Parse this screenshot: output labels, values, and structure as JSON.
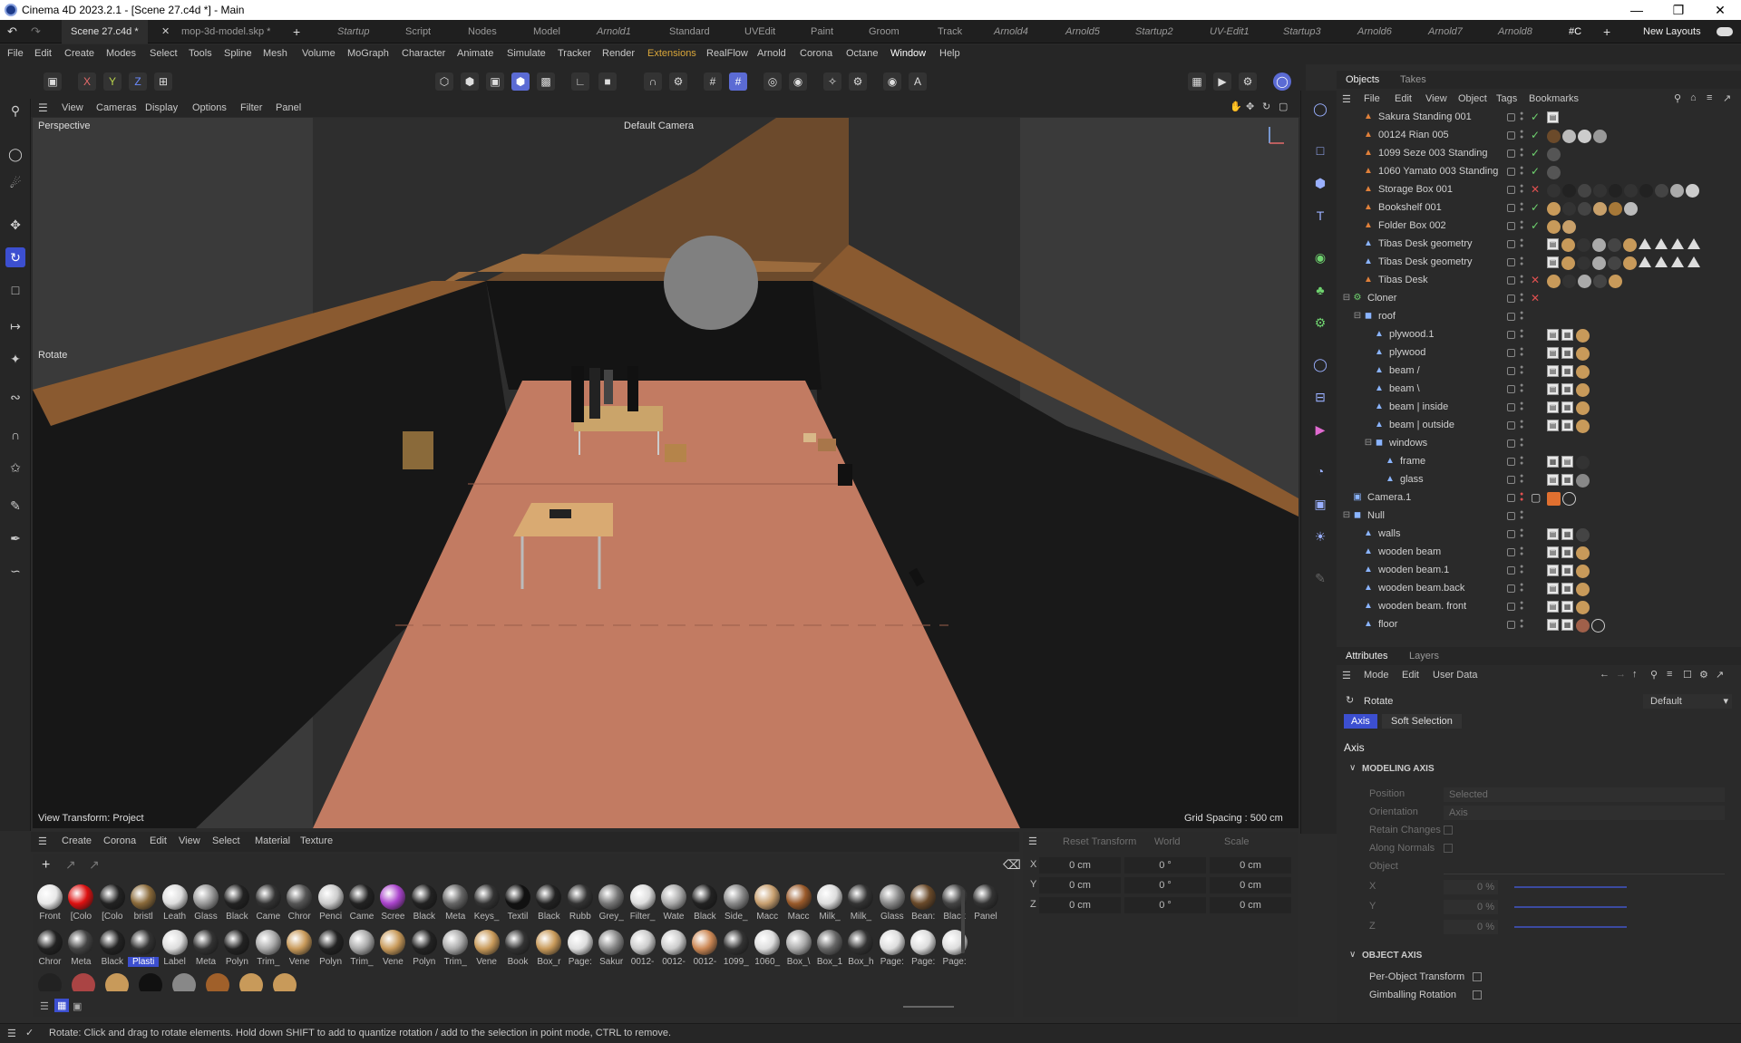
{
  "window": {
    "title": "Cinema 4D 2023.2.1 - [Scene 27.c4d *] - Main"
  },
  "tabs": {
    "active": "Scene 27.c4d *",
    "second": "mop-3d-model.skp *",
    "layouts": [
      "Startup",
      "Script",
      "Nodes",
      "Model",
      "Arnold1",
      "Standard",
      "UVEdit",
      "Paint",
      "Groom",
      "Track",
      "Arnold4",
      "Arnold5",
      "Startup2",
      "UV-Edit1",
      "Startup3",
      "Arnold6",
      "Arnold7",
      "Arnold8",
      "#C"
    ],
    "new_layouts": "New Layouts"
  },
  "menu": [
    "File",
    "Edit",
    "Create",
    "Modes",
    "Select",
    "Tools",
    "Spline",
    "Mesh",
    "Volume",
    "MoGraph",
    "Character",
    "Animate",
    "Simulate",
    "Tracker",
    "Render",
    "Extensions",
    "RealFlow",
    "Arnold",
    "Corona",
    "Octane",
    "Window",
    "Help"
  ],
  "axes": {
    "x": "X",
    "y": "Y",
    "z": "Z"
  },
  "viewport": {
    "menus": [
      "View",
      "Cameras",
      "Display",
      "Options",
      "Filter",
      "Panel"
    ],
    "name": "Perspective",
    "camera": "Default Camera",
    "tool": "Rotate",
    "transform": "View Transform: Project",
    "grid": "Grid Spacing : 500 cm"
  },
  "objects": {
    "tabs": [
      "Objects",
      "Takes"
    ],
    "menus": [
      "File",
      "Edit",
      "View",
      "Object",
      "Tags",
      "Bookmarks"
    ],
    "rows": [
      {
        "name": "Sakura Standing 001"
      },
      {
        "name": "00124 Rian 005"
      },
      {
        "name": "1099 Seze 003 Standing"
      },
      {
        "name": "1060 Yamato 003 Standing"
      },
      {
        "name": "Storage Box 001"
      },
      {
        "name": "Bookshelf 001"
      },
      {
        "name": "Folder Box 002"
      },
      {
        "name": "Tibas Desk geometry"
      },
      {
        "name": "Tibas Desk geometry"
      },
      {
        "name": "Tibas Desk"
      },
      {
        "name": "Cloner"
      },
      {
        "name": "roof"
      },
      {
        "name": "plywood.1"
      },
      {
        "name": "plywood"
      },
      {
        "name": "beam /"
      },
      {
        "name": "beam \\"
      },
      {
        "name": "beam | inside"
      },
      {
        "name": "beam | outside"
      },
      {
        "name": "windows"
      },
      {
        "name": "frame"
      },
      {
        "name": "glass"
      },
      {
        "name": "Camera.1"
      },
      {
        "name": "Null"
      },
      {
        "name": "walls"
      },
      {
        "name": "wooden beam"
      },
      {
        "name": "wooden beam.1"
      },
      {
        "name": "wooden beam.back"
      },
      {
        "name": "wooden beam. front"
      },
      {
        "name": "floor"
      }
    ]
  },
  "attributes": {
    "tabs": [
      "Attributes",
      "Layers"
    ],
    "menus": [
      "Mode",
      "Edit",
      "User Data"
    ],
    "tool": "Rotate",
    "preset": "Default",
    "subtabs": [
      "Axis",
      "Soft Selection"
    ],
    "heading": "Axis",
    "modeling_axis": "MODELING AXIS",
    "position_label": "Position",
    "position_value": "Selected",
    "orientation_label": "Orientation",
    "orientation_value": "Axis",
    "retain": "Retain Changes",
    "along": "Along Normals",
    "object_label": "Object",
    "x_label": "X",
    "y_label": "Y",
    "z_label": "Z",
    "x_val": "0 %",
    "y_val": "0 %",
    "z_val": "0 %",
    "object_axis": "OBJECT AXIS",
    "per_object": "Per-Object Transform",
    "gimballing": "Gimballing Rotation"
  },
  "materials": {
    "menus": [
      "Create",
      "Corona",
      "Edit",
      "View",
      "Select",
      "Material",
      "Texture"
    ],
    "row1": [
      "Front",
      "[Colo",
      "[Colo",
      "bristl",
      "Leath",
      "Glass",
      "Black",
      "Came",
      "Chror",
      "Penci",
      "Came",
      "Scree",
      "Black",
      "Meta",
      "Keys_",
      "Textil",
      "Black",
      "Rubb",
      "Grey_",
      "Filter_",
      "Wate",
      "Black",
      "Side_",
      "Macc",
      "Macc",
      "Milk_",
      "Milk_",
      "Glass",
      "Bean:",
      "Black",
      "Panel"
    ],
    "row2": [
      "Chror",
      "Meta",
      "Black",
      "Plasti",
      "Label",
      "Meta",
      "Polyn",
      "Trim_",
      "Vene",
      "Polyn",
      "Trim_",
      "Vene",
      "Polyn",
      "Trim_",
      "Vene",
      "Book",
      "Box_r",
      "Page:",
      "Sakur",
      "0012-",
      "0012-",
      "0012-",
      "1099_",
      "1060_",
      "Box_\\",
      "Box_1",
      "Box_h",
      "Page:",
      "Page:",
      "Page:"
    ]
  },
  "coords": {
    "reset": "Reset Transform",
    "world": "World",
    "scale": "Scale",
    "x": "X",
    "y": "Y",
    "z": "Z",
    "px": "0 cm",
    "py": "0 cm",
    "pz": "0 cm",
    "rx": "0 °",
    "ry": "0 °",
    "rz": "0 °",
    "sx": "0 cm",
    "sy": "0 cm",
    "sz": "0 cm"
  },
  "status": {
    "text": "Rotate: Click and drag to rotate elements. Hold down SHIFT to add to quantize rotation / add to the selection in point mode, CTRL to remove."
  },
  "colors": {
    "accent": "#3c4fd0",
    "highlight": "#d9a63a",
    "floor": "#c27b62",
    "wood": "#8a5a30"
  }
}
